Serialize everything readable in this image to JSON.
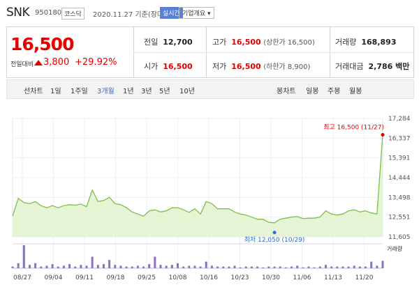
{
  "header": {
    "name": "SNK",
    "code": "950180",
    "market": "코스닥",
    "date": "2020.11.27 기준(장마감)",
    "realtime": "실시간",
    "corp_info": "기업개요 ▾"
  },
  "quote": {
    "price": "16,500",
    "change_label": "전일대비",
    "change_amount": "3,800",
    "change_pct": "+29.92%",
    "prev_label": "전일",
    "prev": "12,700",
    "high_label": "고가",
    "high": "16,500",
    "upper_limit": "(상한가 16,500)",
    "volume_label": "거래량",
    "volume": "168,893",
    "open_label": "시가",
    "open": "16,500",
    "low_label": "저가",
    "low": "16,500",
    "lower_limit": "(하한가 8,900)",
    "amount_label": "거래대금",
    "amount": "2,786 백만"
  },
  "tabs": {
    "line_label": "선차트",
    "periods": [
      "1일",
      "1주일",
      "3개월",
      "1년",
      "3년",
      "5년",
      "10년"
    ],
    "selected": "3개월",
    "candle_label": "봉차트",
    "candle": [
      "일봉",
      "주봉",
      "월봉"
    ]
  },
  "chart_data": {
    "type": "area",
    "y_ticks": [
      "17,284",
      "16,337",
      "15,391",
      "14,444",
      "13,498",
      "12,551",
      "11,605"
    ],
    "ylim": [
      11605,
      17284
    ],
    "x_ticks": [
      "08/27",
      "09/04",
      "09/11",
      "09/18",
      "09/25",
      "10/08",
      "10/16",
      "10/23",
      "10/30",
      "11/06",
      "11/13",
      "11/20"
    ],
    "prices": [
      12600,
      13450,
      13250,
      13200,
      13300,
      13100,
      13000,
      13100,
      13000,
      13100,
      13150,
      13120,
      13180,
      13050,
      13850,
      13300,
      13350,
      13500,
      13200,
      13150,
      13000,
      12800,
      12700,
      12600,
      12850,
      12900,
      12800,
      12850,
      13000,
      13000,
      12900,
      12780,
      12950,
      12700,
      13300,
      13200,
      12950,
      12950,
      12950,
      12800,
      12700,
      12650,
      12550,
      12450,
      12450,
      12300,
      12280,
      12450,
      12500,
      12550,
      12580,
      12480,
      12500,
      12500,
      12550,
      12850,
      12700,
      12650,
      12700,
      12850,
      12900,
      12800,
      12850,
      12750,
      12700,
      16500
    ],
    "volumes": [
      2,
      6,
      28,
      4,
      6,
      2,
      3,
      5,
      2,
      3,
      5,
      2,
      4,
      3,
      14,
      4,
      5,
      10,
      4,
      3,
      2,
      2,
      3,
      2,
      5,
      14,
      4,
      3,
      4,
      6,
      2,
      3,
      3,
      2,
      8,
      3,
      2,
      2,
      2,
      3,
      1,
      2,
      2,
      2,
      1,
      2,
      2,
      2,
      1,
      2,
      3,
      1,
      2,
      1,
      2,
      4,
      2,
      2,
      2,
      2,
      3,
      2,
      2,
      8,
      3,
      9
    ],
    "high_label": "최고 16,500 (11/27)",
    "low_label": "최저 12,050 (10/29)",
    "volume_label": "거래량",
    "colors": {
      "line": "#7cc04a",
      "fill": "#e6f4d6",
      "volume": "#8a6fc4",
      "high": "#e30000",
      "low": "#2a6bd6"
    }
  }
}
